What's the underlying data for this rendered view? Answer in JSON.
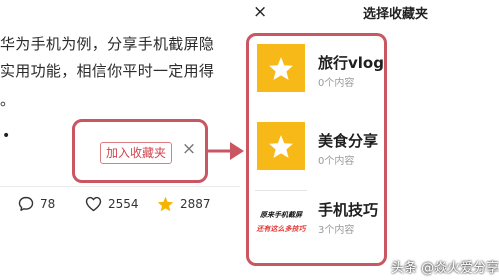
{
  "article": {
    "line1": "华为手机为例，分享手机截屏隐",
    "line2": "实用功能，相信你平时一定用得",
    "line3": "。",
    "bullet": "•"
  },
  "fav_popup": {
    "add_label": "加入收藏夹",
    "close_icon": "×"
  },
  "stats": {
    "comments": "78",
    "likes": "2554",
    "favorites": "2887"
  },
  "panel": {
    "close_icon": "×",
    "title": "选择收藏夹",
    "folders": [
      {
        "name": "旅行vlog",
        "count": "0个内容"
      },
      {
        "name": "美食分享",
        "count": "0个内容"
      },
      {
        "name": "手机技巧",
        "count": "3个内容",
        "thumb_line1": "原来手机截屏",
        "thumb_line2": "还有这么多技巧"
      }
    ]
  },
  "watermark": {
    "text": "头条 @焱火爱分享"
  },
  "colors": {
    "highlight": "#c95660",
    "folder_thumb": "#f7b917",
    "star": "#f5b400",
    "button_text": "#d2454f"
  }
}
